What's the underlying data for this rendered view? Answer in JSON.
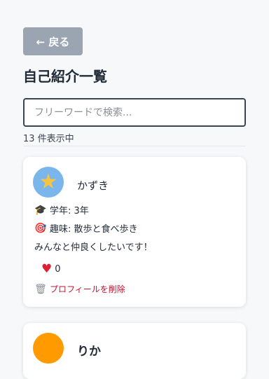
{
  "header": {
    "back_label": "← 戻る",
    "title": "自己紹介一覧"
  },
  "search": {
    "placeholder": "フリーワードで検索...",
    "value": ""
  },
  "result_count": "13 件表示中",
  "profiles": [
    {
      "name": "かずき",
      "avatar_icon": "star-icon",
      "avatar_color": "#7ab6ec",
      "grade_icon": "graduation-cap-icon",
      "grade": "学年: 3年",
      "hobby_icon": "target-icon",
      "hobby": "趣味: 散歩と食べ歩き",
      "message": "みんなと仲良くしたいです！",
      "likes": "0",
      "delete_label": "プロフィールを削除"
    },
    {
      "name": "りか",
      "avatar_color": "#ff9a00"
    }
  ]
}
